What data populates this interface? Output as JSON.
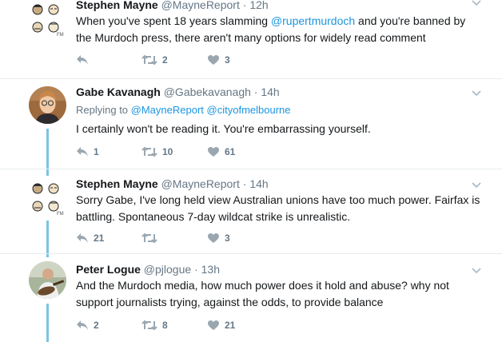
{
  "tweets": [
    {
      "name": "Stephen Mayne",
      "handle": "@MayneReport",
      "dot": "·",
      "time": "12h",
      "text_before": "When you've spent 18 years slamming ",
      "mention": "@rupertmurdoch",
      "text_after": " and you're banned by the Murdoch press, there aren't many options for widely read comment",
      "reply_count": "",
      "retweet_count": "2",
      "like_count": "3",
      "avatar": "cartoon-avatar"
    },
    {
      "name": "Gabe Kavanagh",
      "handle": "@Gabekavanagh",
      "dot": "·",
      "time": "14h",
      "replying_prefix": "Replying to ",
      "replying_1": "@MayneReport",
      "replying_2": "@cityofmelbourne",
      "text": "I certainly won't be reading it. You're embarrassing yourself.",
      "reply_count": "1",
      "retweet_count": "10",
      "like_count": "61",
      "avatar": "photo-avatar"
    },
    {
      "name": "Stephen Mayne",
      "handle": "@MayneReport",
      "dot": "·",
      "time": "14h",
      "text": "Sorry Gabe, I've long held view Australian unions have too much power. Fairfax is battling. Spontaneous 7-day wildcat strike is unrealistic.",
      "reply_count": "21",
      "retweet_count": "",
      "like_count": "3",
      "avatar": "cartoon-avatar"
    },
    {
      "name": "Peter Logue",
      "handle": "@pjlogue",
      "dot": "·",
      "time": "13h",
      "text": "And the Murdoch media, how much power does it hold and abuse? why not support journalists trying, against the odds, to provide balance",
      "reply_count": "2",
      "retweet_count": "8",
      "like_count": "21",
      "avatar": "photo-avatar"
    }
  ],
  "colors": {
    "link": "#1b95e0",
    "muted": "#657786",
    "thread": "#79c4e5",
    "divider": "#e6ecf0"
  },
  "icons": [
    "reply-icon",
    "retweet-icon",
    "heart-icon",
    "chevron-down-icon"
  ]
}
